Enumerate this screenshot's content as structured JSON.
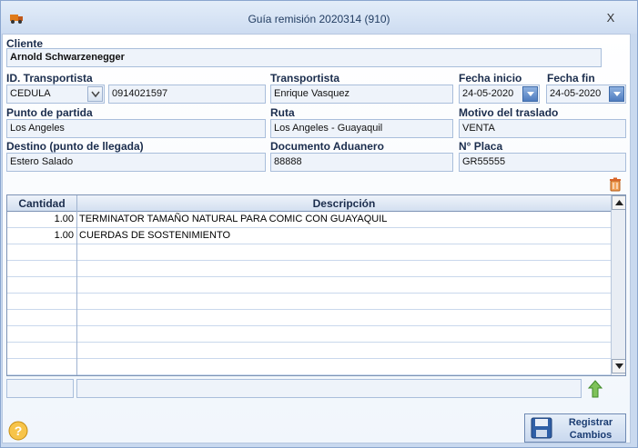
{
  "window": {
    "title": "Guía remisión 2020314 (910)",
    "close_glyph": "X"
  },
  "cliente": {
    "label": "Cliente",
    "value": "Arnold Schwarzenegger"
  },
  "id_transportista": {
    "label": "ID. Transportista",
    "type_value": "CEDULA",
    "number_value": "0914021597"
  },
  "transportista": {
    "label": "Transportista",
    "value": "Enrique Vasquez"
  },
  "fecha_inicio": {
    "label": "Fecha inicio",
    "value": "24-05-2020"
  },
  "fecha_fin": {
    "label": "Fecha fin",
    "value": "24-05-2020"
  },
  "punto_partida": {
    "label": "Punto de partida",
    "value": "Los Angeles"
  },
  "ruta": {
    "label": "Ruta",
    "value": "Los Angeles - Guayaquil"
  },
  "motivo": {
    "label": "Motivo del traslado",
    "value": "VENTA"
  },
  "destino": {
    "label": "Destino (punto de llegada)",
    "value": "Estero Salado"
  },
  "doc_aduanero": {
    "label": "Documento Aduanero",
    "value": "88888"
  },
  "placa": {
    "label": "N° Placa",
    "value": "GR55555"
  },
  "table": {
    "headers": {
      "cantidad": "Cantidad",
      "descripcion": "Descripción"
    },
    "rows": [
      {
        "cantidad": "1.00",
        "descripcion": "TERMINATOR TAMAÑO NATURAL PARA COMIC CON GUAYAQUIL"
      },
      {
        "cantidad": "1.00",
        "descripcion": "CUERDAS DE SOSTENIMIENTO"
      },
      {
        "cantidad": "",
        "descripcion": ""
      },
      {
        "cantidad": "",
        "descripcion": ""
      },
      {
        "cantidad": "",
        "descripcion": ""
      },
      {
        "cantidad": "",
        "descripcion": ""
      },
      {
        "cantidad": "",
        "descripcion": ""
      },
      {
        "cantidad": "",
        "descripcion": ""
      },
      {
        "cantidad": "",
        "descripcion": ""
      },
      {
        "cantidad": "",
        "descripcion": ""
      }
    ]
  },
  "footer": {
    "save_label_line1": "Registrar",
    "save_label_line2": "Cambios"
  },
  "icons": {
    "title": "truck-icon",
    "delete": "trash-icon",
    "add": "up-arrow-icon",
    "help": "help-icon",
    "save": "floppy-disk-icon"
  },
  "colors": {
    "accent": "#4f7cbf",
    "window_bg": "#c9d9ef",
    "label": "#1b2d4d"
  }
}
